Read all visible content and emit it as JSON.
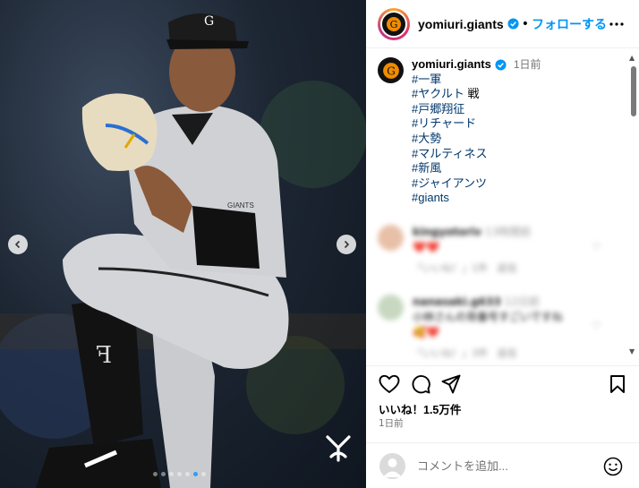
{
  "photo": {
    "description_icon": "baseball-pitcher-photo",
    "slide_count": 7,
    "active_slide": 5,
    "watermark_icon": "giants-yg-logo-icon",
    "jersey_text": "G",
    "sleeve_text": "GIANTS"
  },
  "header": {
    "username": "yomiuri.giants",
    "separator": "•",
    "follow_label": "フォローする",
    "more_icon": "more-horizontal-icon"
  },
  "caption": {
    "username": "yomiuri.giants",
    "time": "1日前",
    "tags": [
      "#一軍",
      "#ヤクルト",
      "#戸郷翔征",
      "#リチャード",
      "#大勢",
      "#マルティネス",
      "#新風",
      "#ジャイアンツ",
      "#giants"
    ],
    "tag2_suffix": " 戦"
  },
  "comments": [
    {
      "name": "kingyotoriv",
      "time": "13時間前",
      "text": "❤️❤️",
      "meta_likes": "「いいね！」1件",
      "meta_reply": "返信"
    },
    {
      "name": "nanasaki.g633",
      "time": "12日前",
      "text": "小林さんの背番号すごいですね",
      "text2": "🥰❤️",
      "meta_likes": "「いいね！」3件",
      "meta_reply": "返信"
    }
  ],
  "actions": {
    "likes": "いいね！1.5万件",
    "time": "1日前",
    "comment_placeholder": "コメントを追加...",
    "icons": [
      "heart-icon",
      "comment-icon",
      "share-icon",
      "bookmark-icon",
      "emoji-icon"
    ]
  },
  "colors": {
    "accent": "#0095f6",
    "hashtag": "#00376b",
    "active_dot": "#2f9bff"
  }
}
